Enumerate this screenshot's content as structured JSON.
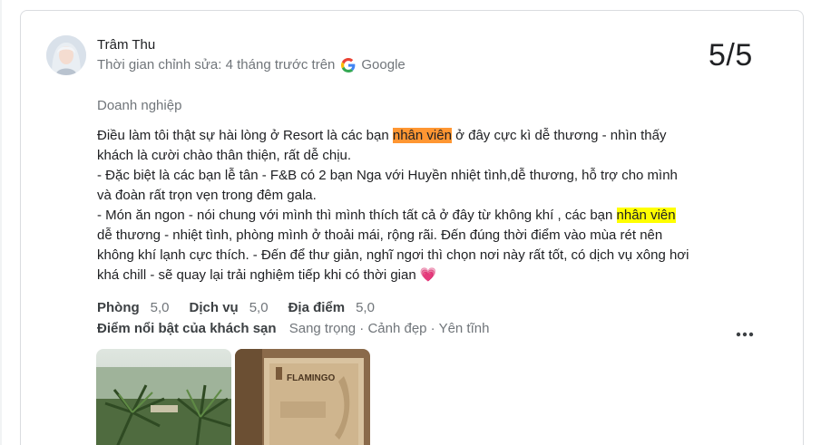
{
  "review": {
    "reviewer_name": "Trâm Thu",
    "edited_text": "Thời gian chỉnh sửa: 4 tháng trước trên",
    "source": "Google",
    "score": "5/5",
    "trip_type": "Doanh nghiệp",
    "text": {
      "l1_a": "Điều làm tôi thật sự hài lòng ở Resort là các bạn ",
      "l1_hl": "nhân viên",
      "l1_b": " ở đây cực kì dễ thương - nhìn thấy",
      "l2": "khách là cười chào thân thiện, rất dễ chịu.",
      "l3": "- Đặc biệt là các bạn lễ tân - F&B có 2 bạn Nga với Huyền nhiệt tình,dễ thương, hỗ trợ cho mình",
      "l4": "và đoàn rất trọn vẹn trong đêm gala.",
      "l5_a": "- Món ăn ngon - nói chung với mình thì mình thích tất cả ở đây từ không khí , các bạn ",
      "l5_hl": "nhân viên",
      "l6": "dễ thương - nhiệt tình, phòng mình ở thoải mái, rộng rãi. Đến đúng thời điểm vào mùa rét nên",
      "l7": "không khí lạnh cực thích. - Đến để thư giản, nghĩ ngơi thì chọn nơi này rất tốt, có dịch vụ xông hơi",
      "l8": "khá chill - sẽ quay lại trải nghiệm tiếp khi có thời gian",
      "heart": "💗"
    },
    "ratings": [
      {
        "label": "Phòng",
        "value": "5,0"
      },
      {
        "label": "Dịch vụ",
        "value": "5,0"
      },
      {
        "label": "Địa điểm",
        "value": "5,0"
      }
    ],
    "highlights_label": "Điểm nổi bật của khách sạn",
    "highlights_value": "Sang trọng · Cảnh đẹp · Yên tĩnh",
    "photo2_brand": "FLAMINGO",
    "more_icon": "more-horizontal-icon"
  },
  "colors": {
    "highlight_orange": "#ff9632",
    "highlight_yellow": "#ffff00",
    "muted_text": "#70757a"
  }
}
